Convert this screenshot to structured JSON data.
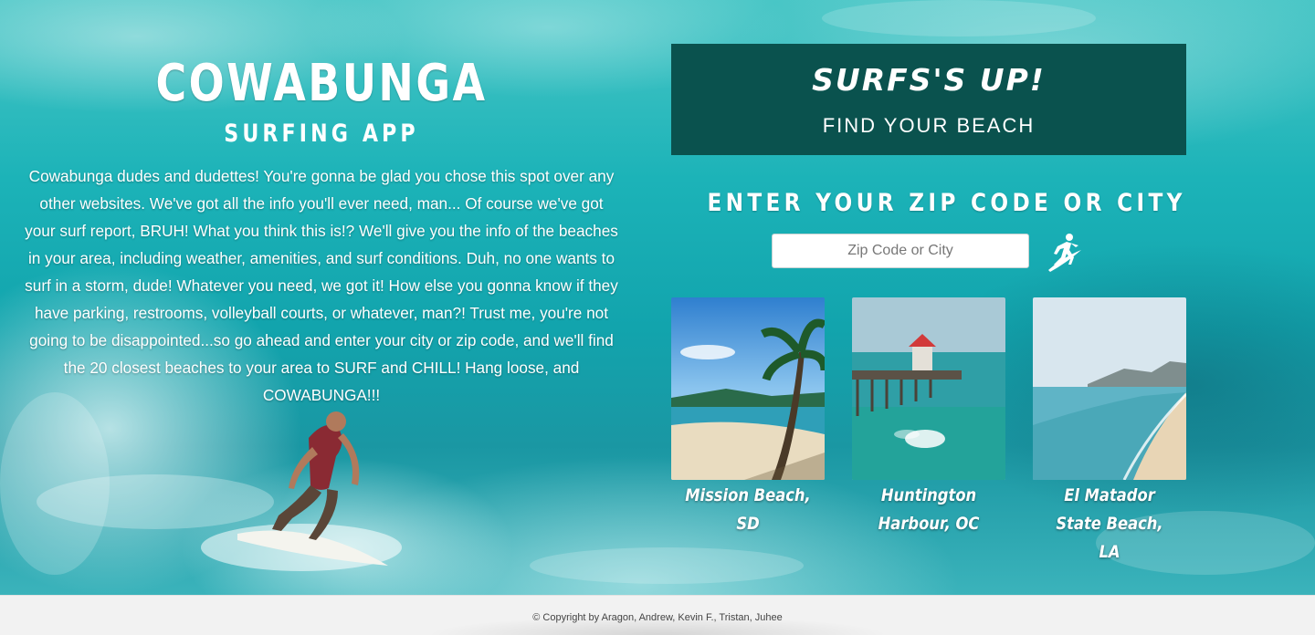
{
  "brand": {
    "title": "COWABUNGA",
    "subtitle": "SURFING APP",
    "intro": "Cowabunga dudes and dudettes! You're gonna be glad you chose this spot over any other websites. We've got all the info you'll ever need, man... Of course we've got your surf report, BRUH! What you think this is!? We'll give you the info of the beaches in your area, including weather, amenities, and surf conditions. Duh, no one wants to surf in a storm, dude! Whatever you need, we got it! How else you gonna know if they have parking, restrooms, volleyball courts, or whatever, man?! Trust me, you're not going to be disappointed...so go ahead and enter your city or zip code, and we'll find the 20 closest beaches to your area to SURF and CHILL! Hang loose, and COWABUNGA!!!"
  },
  "banner": {
    "title": "SURFS'S UP!",
    "subtitle": "FIND YOUR BEACH"
  },
  "search": {
    "heading": "ENTER YOUR ZIP CODE OR CITY",
    "placeholder": "Zip Code or City",
    "value": "",
    "button_icon": "surfer-icon"
  },
  "beaches": [
    {
      "name": "Mission Beach, SD",
      "image": "tropical-beach-palm"
    },
    {
      "name": "Huntington Harbour, OC",
      "image": "pier-ocean"
    },
    {
      "name": "El Matador State Beach, LA",
      "image": "coastline-mountains"
    }
  ],
  "footer": {
    "copyright": "© Copyright by Aragon, Andrew, Kevin F., Tristan, Juhee"
  },
  "colors": {
    "banner_bg": "#0a524e",
    "ocean": "#12a4ad",
    "footer_bg": "#f2f2f2"
  }
}
